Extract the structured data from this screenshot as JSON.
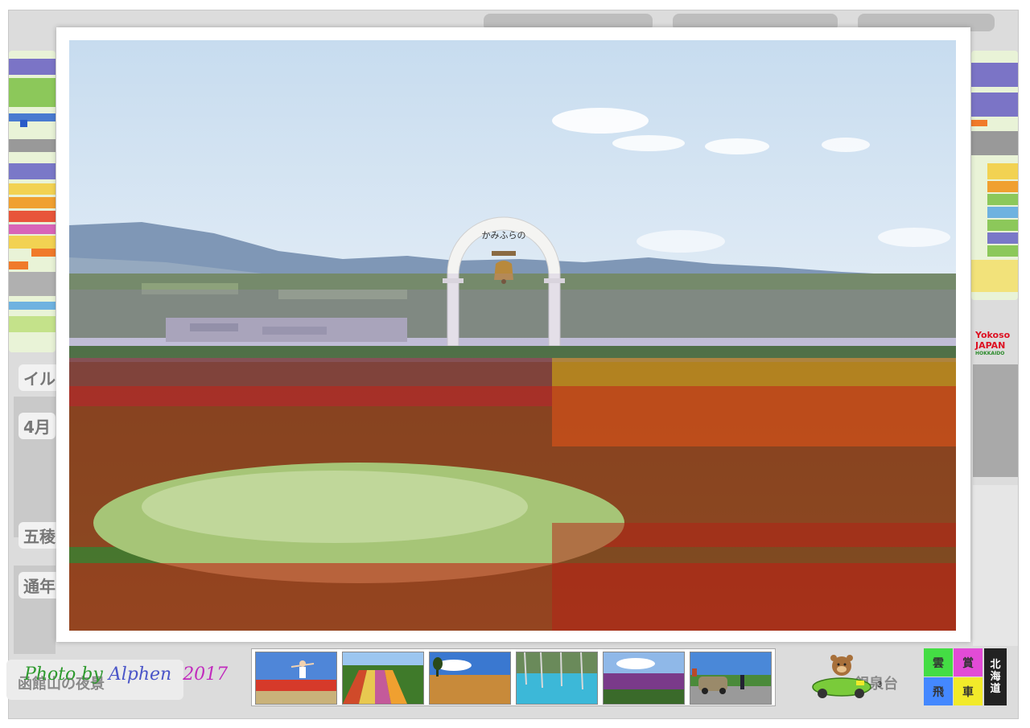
{
  "background": {
    "labels": [
      "4月",
      "五稜",
      "通年",
      "イル"
    ],
    "bottom_left_text": "函館山の夜景",
    "bottom_right_text": "銀泉台"
  },
  "main_photo": {
    "arch_text": "かみふらの",
    "description_icon": "flower-hill-photo"
  },
  "credit": {
    "photo_by": "Photo by",
    "name": "Alphen",
    "year": "2017"
  },
  "thumbnails": [
    {
      "name": "thumb-girl-flowers"
    },
    {
      "name": "thumb-striped-fields"
    },
    {
      "name": "thumb-wheat-tree"
    },
    {
      "name": "thumb-blue-pond"
    },
    {
      "name": "thumb-purple-flowers"
    },
    {
      "name": "thumb-car-road"
    }
  ],
  "badge": {
    "cells": [
      "雲",
      "賞",
      "飛",
      "車"
    ],
    "vertical": [
      "北",
      "海",
      "道"
    ],
    "colors": [
      "#44dd44",
      "#e24bd6",
      "#4488ff",
      "#f2ea2a"
    ]
  },
  "yokoso": {
    "line1": "Yokoso",
    "line2": "JAPAN",
    "line3": "HOKKAIDO"
  }
}
